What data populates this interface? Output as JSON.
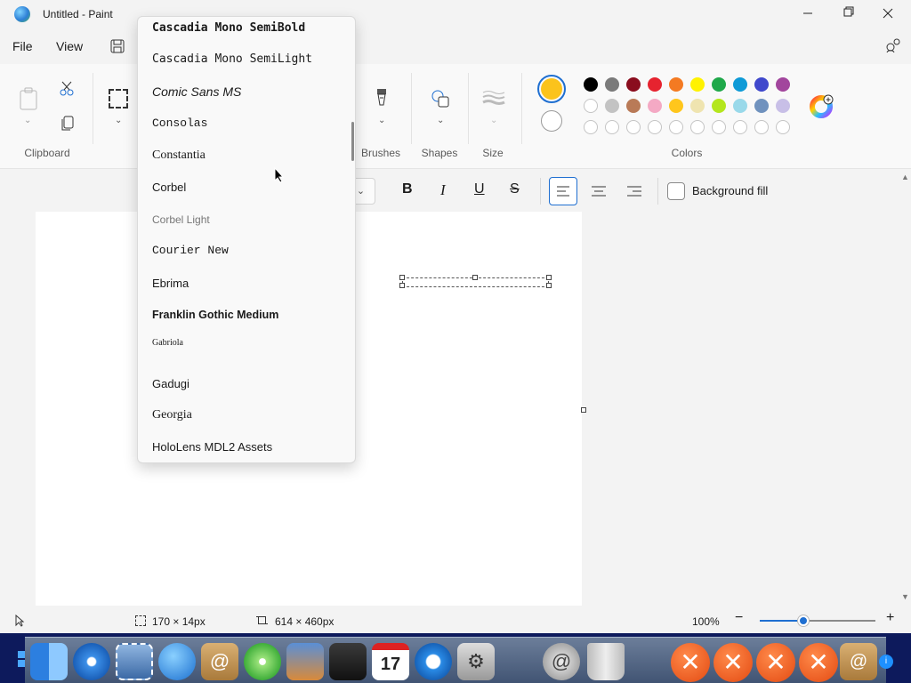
{
  "window": {
    "title": "Untitled - Paint"
  },
  "menu": {
    "file": "File",
    "view": "View"
  },
  "ribbon": {
    "groups": {
      "clipboard": "Clipboard",
      "brushes": "Brushes",
      "shapes": "Shapes",
      "size": "Size",
      "colors": "Colors"
    },
    "primary_color": "#fbc31c",
    "secondary_color": "#ffffff",
    "palette_row1": [
      "#000000",
      "#7a7a7a",
      "#8a0d1e",
      "#e6232f",
      "#f47a22",
      "#fff200",
      "#1fa84a",
      "#0e9ad7",
      "#3f48cc",
      "#a2469d"
    ],
    "palette_row2": [
      "#ffffff",
      "#c3c3c3",
      "#b97a57",
      "#f4a9c4",
      "#ffc61c",
      "#efe4b0",
      "#b4e61d",
      "#99d9ea",
      "#7092be",
      "#c8bfe7"
    ]
  },
  "textbar": {
    "bold": "B",
    "italic": "I",
    "underline": "U",
    "strike": "S",
    "background_fill": "Background fill"
  },
  "font_list": [
    "Cascadia Mono SemiBold",
    "Cascadia Mono SemiLight",
    "Comic Sans MS",
    "Consolas",
    "Constantia",
    "Corbel",
    "Corbel Light",
    "Courier New",
    "Ebrima",
    "Franklin Gothic Medium",
    "Gabriola",
    "Gadugi",
    "Georgia",
    "HoloLens MDL2 Assets"
  ],
  "status": {
    "selection_size": "170 × 14px",
    "canvas_size": "614 × 460px",
    "zoom": "100%",
    "zoom_fraction": 0.38
  },
  "taskbar": {
    "calendar_day": "17"
  }
}
